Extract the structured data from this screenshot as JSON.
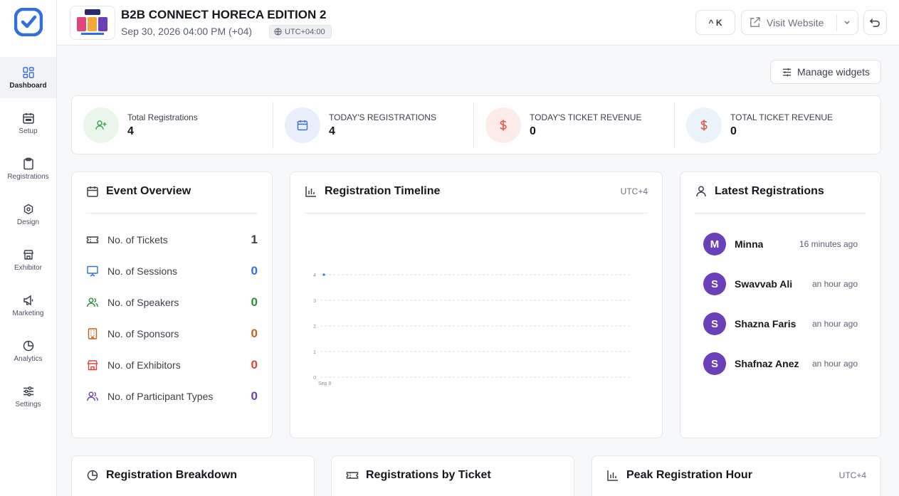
{
  "sidebar": {
    "items": [
      {
        "label": "Dashboard",
        "icon": "dashboard-icon",
        "active": true
      },
      {
        "label": "Setup",
        "icon": "calendar-icon"
      },
      {
        "label": "Registrations",
        "icon": "clipboard-icon"
      },
      {
        "label": "Design",
        "icon": "hexagon-icon"
      },
      {
        "label": "Exhibitor",
        "icon": "store-icon"
      },
      {
        "label": "Marketing",
        "icon": "megaphone-icon"
      },
      {
        "label": "Analytics",
        "icon": "pie-chart-icon"
      },
      {
        "label": "Settings",
        "icon": "sliders-icon"
      }
    ]
  },
  "header": {
    "event_title": "B2B CONNECT HORECA EDITION 2",
    "event_date": "Sep 30, 2026 04:00 PM (+04)",
    "timezone": "UTC+04:00",
    "shortcut_label": "^ K",
    "visit_label": "Visit Website"
  },
  "main": {
    "manage_widgets_label": "Manage widgets",
    "stats": [
      {
        "label": "Total Registrations",
        "value": "4",
        "color": "#3aa655",
        "bg": "#eaf6ec"
      },
      {
        "label": "TODAY'S REGISTRATIONS",
        "value": "4",
        "color": "#3b6fd6",
        "bg": "#e8effb"
      },
      {
        "label": "TODAY'S TICKET REVENUE",
        "value": "0",
        "color": "#e05a4a",
        "bg": "#fcebe8"
      },
      {
        "label": "TOTAL TICKET REVENUE",
        "value": "0",
        "color": "#e05a4a",
        "bg": "#eaf2fb"
      }
    ],
    "event_overview": {
      "title": "Event Overview",
      "rows": [
        {
          "label": "No. of Tickets",
          "value": "1",
          "color": "#3a3f48",
          "icon": "ticket-icon"
        },
        {
          "label": "No. of Sessions",
          "value": "0",
          "color": "#2f6fd6",
          "icon": "presentation-icon"
        },
        {
          "label": "No. of Speakers",
          "value": "0",
          "color": "#2e8b3e",
          "icon": "users-icon"
        },
        {
          "label": "No. of Sponsors",
          "value": "0",
          "color": "#c2621a",
          "icon": "building-icon"
        },
        {
          "label": "No. of Exhibitors",
          "value": "0",
          "color": "#d9453a",
          "icon": "store-icon"
        },
        {
          "label": "No. of Participant Types",
          "value": "0",
          "color": "#6a3fb8",
          "icon": "user-group-icon"
        }
      ]
    },
    "timeline": {
      "title": "Registration Timeline",
      "timezone": "UTC+4"
    },
    "latest": {
      "title": "Latest Registrations",
      "items": [
        {
          "initial": "M",
          "name": "Minna",
          "time": "16 minutes ago"
        },
        {
          "initial": "S",
          "name": "Swavvab Ali",
          "time": "an hour ago"
        },
        {
          "initial": "S",
          "name": "Shazna Faris",
          "time": "an hour ago"
        },
        {
          "initial": "S",
          "name": "Shafnaz Anez",
          "time": "an hour ago"
        }
      ]
    },
    "bottom_cards": [
      {
        "title": "Registration Breakdown",
        "icon": "pie-chart-icon"
      },
      {
        "title": "Registrations by Ticket",
        "icon": "ticket-icon"
      },
      {
        "title": "Peak Registration Hour",
        "icon": "bar-chart-icon",
        "aside": "UTC+4"
      }
    ]
  },
  "chart_data": {
    "type": "line",
    "x": [
      "Sep 8"
    ],
    "series": [
      {
        "values": [
          4
        ]
      }
    ],
    "yticks": [
      0,
      1,
      2,
      3,
      4
    ],
    "ylim": [
      0,
      4
    ],
    "grid": true
  }
}
